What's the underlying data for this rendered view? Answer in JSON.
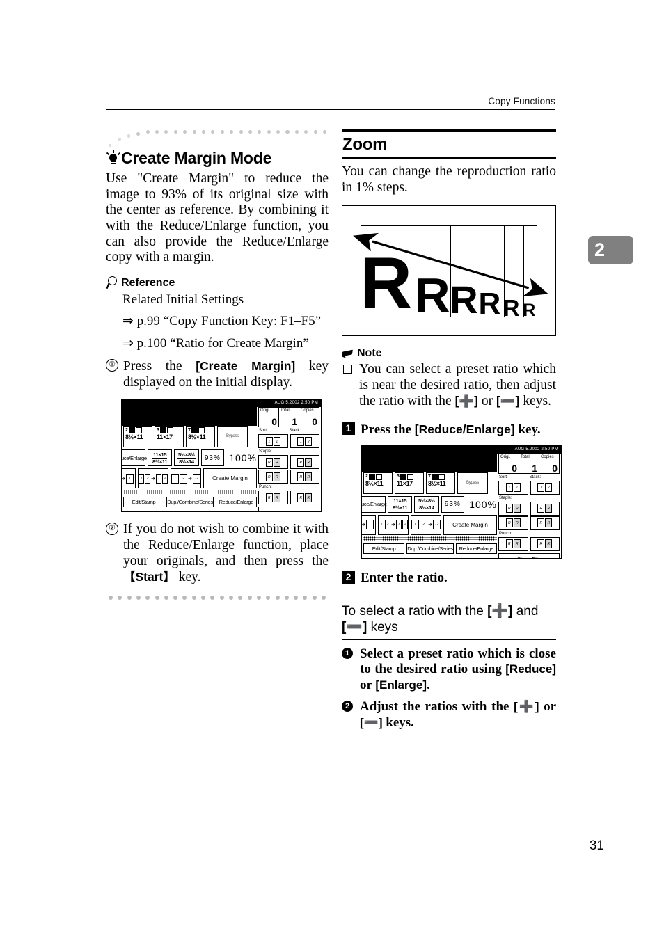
{
  "header": {
    "running_title": "Copy Functions"
  },
  "chapter_tab": {
    "number": "2"
  },
  "page_number": "31",
  "left_column": {
    "section_title": "Create Margin Mode",
    "intro": "Use \"Create Margin\" to reduce the image to 93% of its original size with the center as reference. By combining it with the Reduce/Enlarge function, you can also provide the Reduce/Enlarge copy with a margin.",
    "reference_label": "Reference",
    "reference_intro": "Related Initial Settings",
    "reference_links": [
      "⇒ p.99 “Copy Function Key: F1–F5”",
      "⇒ p.100 “Ratio for Create Margin”"
    ],
    "steps": [
      {
        "num": "①",
        "pre": "Press the ",
        "key": "[Create Margin]",
        "post": " key displayed on the initial display."
      },
      {
        "num": "②",
        "pre": "If you do not wish to combine it with the Reduce/Enlarge function, place your originals, and then press the ",
        "key": "【Start】",
        "post": " key."
      }
    ]
  },
  "right_column": {
    "section_title": "Zoom",
    "intro": "You can change the reproduction ratio in 1% steps.",
    "figure": {
      "caption_letters": [
        "R",
        "R",
        "R",
        "R",
        "R",
        "R"
      ],
      "arrow": "diagonal-arrow-down-right"
    },
    "note_label": "Note",
    "note_items": [
      {
        "pre": "You can select a preset ratio which is near the desired ratio, then adjust the ratio with the ",
        "k1": "[➕]",
        "mid": " or ",
        "k2": "[➖]",
        "post": " keys."
      }
    ],
    "step1": {
      "num": "1",
      "pre": "Press the ",
      "key": "[Reduce/Enlarge]",
      "post": " key."
    },
    "step2": {
      "num": "2",
      "text": "Enter the ratio."
    },
    "subsection": {
      "pre": "To select a ratio with the ",
      "k1": "[➕]",
      "mid": " and ",
      "k2": "[➖]",
      "post": " keys"
    },
    "sub_steps": [
      {
        "num": "❶",
        "pre": "Select a preset ratio which is close to the desired ratio using ",
        "k1": "[Reduce]",
        "mid": " or ",
        "k2": "[Enlarge]",
        "post": "."
      },
      {
        "num": "❷",
        "pre": "Adjust the ratios with the ",
        "k1": "[➕]",
        "mid": " or ",
        "k2": "[➖]",
        "post": " keys."
      }
    ]
  },
  "lcd": {
    "status_bar": "AUG   5.2002   2:50 PM",
    "counters": [
      {
        "label": "Origi.",
        "value": "0"
      },
      {
        "label": "Total",
        "value": "1"
      },
      {
        "label": "Copies",
        "value": "0"
      }
    ],
    "paper_trays": [
      {
        "tray": "2",
        "size": "8½×11"
      },
      {
        "tray": "3",
        "size": "11×17"
      },
      {
        "tray": "T",
        "size": "8½×11"
      }
    ],
    "bypass_label": "Bypass",
    "reduce_enlarge_label": "Reduce/Enlarge",
    "ratio_presets": [
      {
        "top": "11×15",
        "bottom": "8½×11"
      },
      {
        "top": "5½×8½",
        "bottom": "8½×14"
      }
    ],
    "ratio_93": "93%",
    "ratio_current": "100%",
    "create_margin_label": "Create Margin",
    "finisher_groups": [
      {
        "label": "Sort:"
      },
      {
        "label": "Stack:"
      },
      {
        "label": "Staple:"
      },
      {
        "label": "Punch:"
      }
    ],
    "store_file_label": "Store File",
    "bottom_tabs": [
      "Edit/Stamp",
      "Dup./Combine/Series",
      "Reduce/Enlarge"
    ]
  }
}
